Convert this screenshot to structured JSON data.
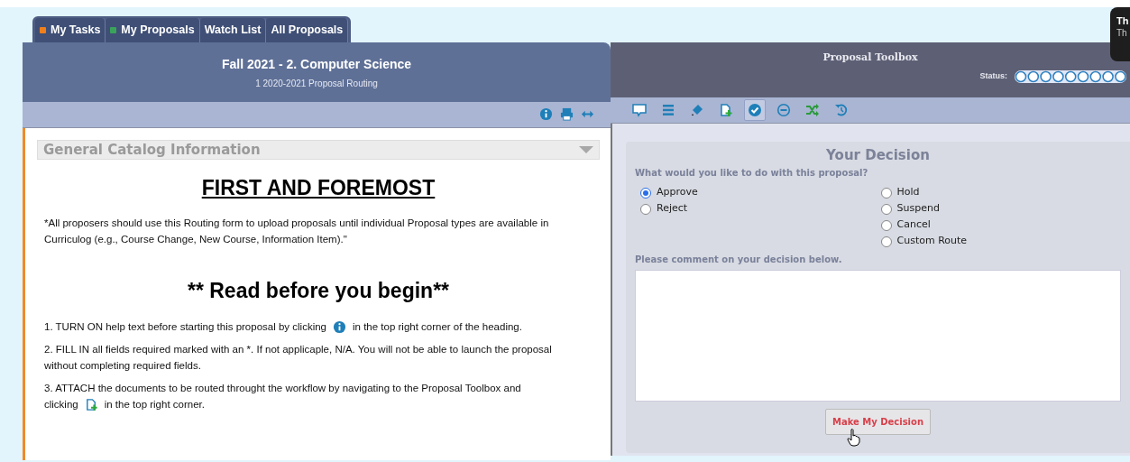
{
  "tabs": [
    {
      "label": "My Tasks",
      "color": "#f07f1a"
    },
    {
      "label": "My Proposals",
      "color": "#3aa35a"
    },
    {
      "label": "Watch List"
    },
    {
      "label": "All Proposals"
    }
  ],
  "proposal": {
    "title": "Fall 2021 - 2. Computer Science",
    "subtitle": "1 2020-2021 Proposal Routing",
    "tools": [
      {
        "kind": "info"
      },
      {
        "kind": "print"
      },
      {
        "kind": "expand"
      }
    ]
  },
  "section": {
    "title": "General Catalog Information",
    "expanded": true
  },
  "content": {
    "heading": "FIRST AND FOREMOST",
    "intro": "*All proposers should use this Routing form to upload proposals until individual Proposal types are available in Curriculog (e.g., Course Change, New Course, Information Item).\"",
    "subheading": "** Read before you begin**",
    "steps": [
      {
        "lines": [
          [
            {
              "kind": "text",
              "text": "1. TURN ON help text before starting this proposal by clicking"
            },
            {
              "kind": "info"
            },
            {
              "kind": "text",
              "text": "in the top right corner of the heading."
            }
          ]
        ]
      },
      {
        "lines": [
          [
            {
              "kind": "text",
              "text": "2. FILL IN all fields required marked with an *. If not applicaple, N/A. You will not be able to launch the proposal without completing required fields."
            }
          ]
        ]
      },
      {
        "lines": [
          [
            {
              "kind": "text",
              "text": "3. ATTACH the documents to be routed throught the workflow by navigating to the Proposal Toolbox and"
            }
          ],
          [
            {
              "kind": "text",
              "text": "clicking"
            },
            {
              "kind": "attach"
            },
            {
              "kind": "text",
              "text": "in the top right corner."
            }
          ]
        ]
      }
    ]
  },
  "toolbox": {
    "title": "Proposal Toolbox",
    "status_label": "Status:",
    "tools": [
      {
        "kind": "comment",
        "selected": false
      },
      {
        "kind": "list",
        "selected": false
      },
      {
        "kind": "edit",
        "selected": false
      },
      {
        "kind": "attach",
        "selected": false
      },
      {
        "kind": "decision",
        "selected": true
      },
      {
        "kind": "minus",
        "selected": false
      },
      {
        "kind": "shuffle",
        "selected": false
      },
      {
        "kind": "history",
        "selected": false
      }
    ]
  },
  "decision": {
    "title": "Your Decision",
    "question": "What would you like to do with this proposal?",
    "option_columns": [
      [
        {
          "label": "Approve",
          "selected": true
        },
        {
          "label": "Reject",
          "selected": false
        }
      ],
      [
        {
          "label": "Hold",
          "selected": false
        },
        {
          "label": "Suspend",
          "selected": false
        },
        {
          "label": "Cancel",
          "selected": false
        },
        {
          "label": "Custom Route",
          "selected": false
        }
      ]
    ],
    "comment_label": "Please comment on your decision below.",
    "button": "Make My Decision"
  },
  "tooltip": {
    "lines": [
      "Th",
      "Th"
    ]
  }
}
